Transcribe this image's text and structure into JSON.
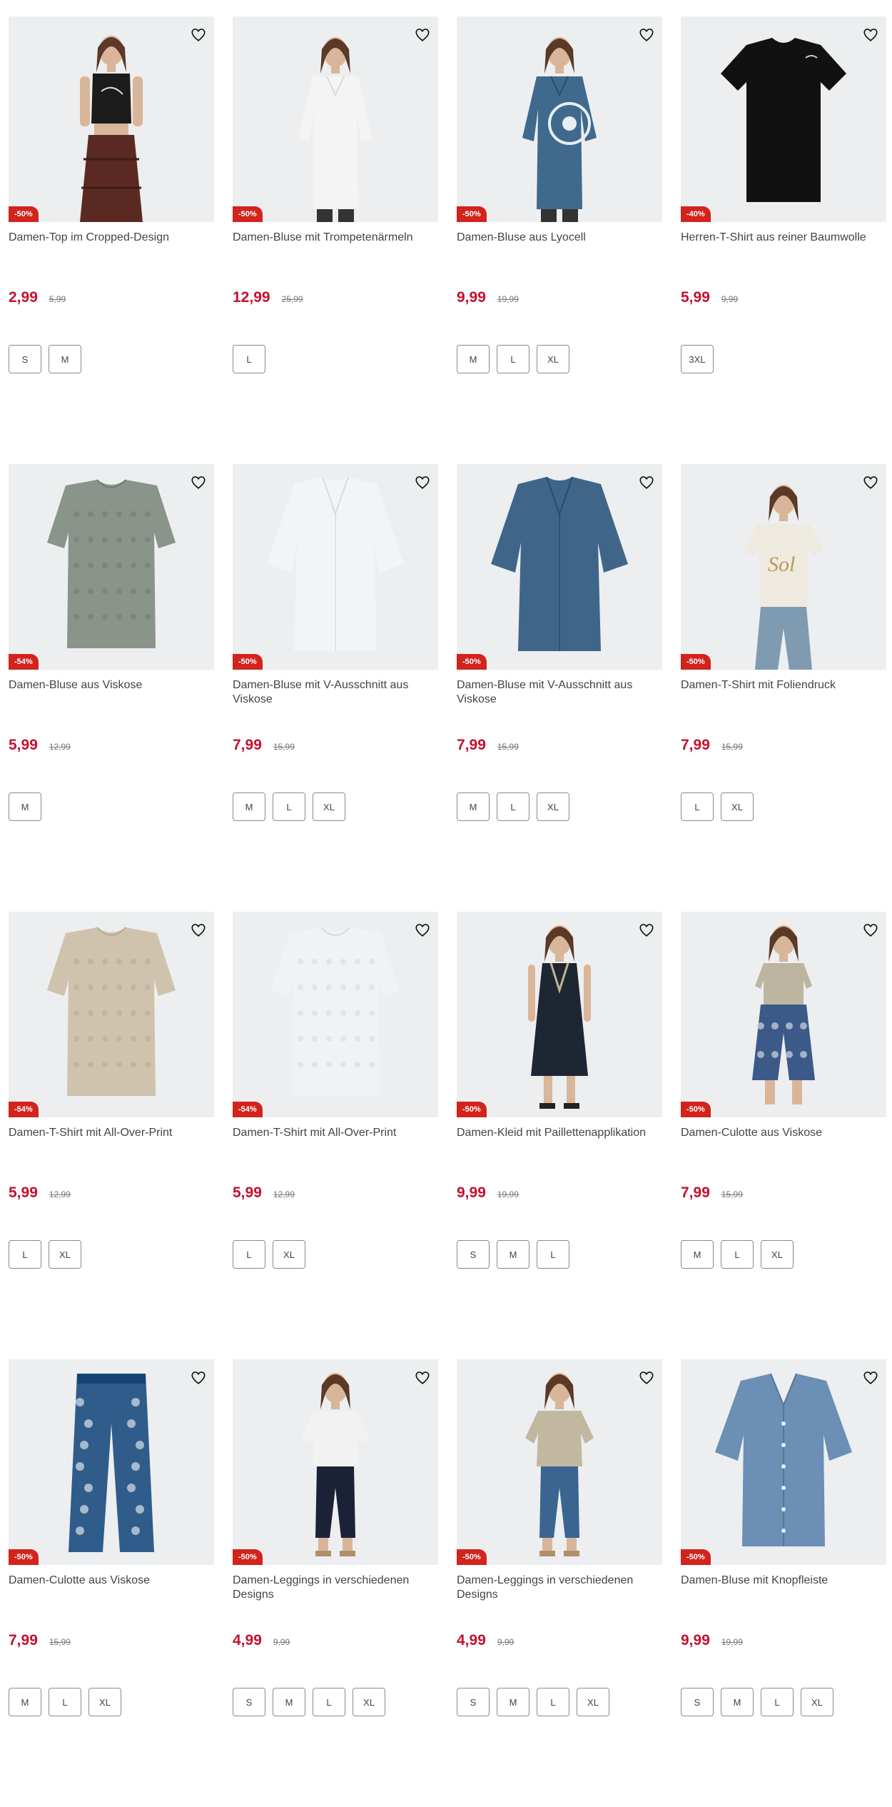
{
  "products": [
    {
      "title": "Damen-Top im Cropped-Design",
      "badge": "-50%",
      "price": "2,99",
      "old_price": "5,99",
      "sizes": [
        "S",
        "M"
      ],
      "art": "top",
      "color": "#1c1c1c"
    },
    {
      "title": "Damen-Bluse mit Trompetenärmeln",
      "badge": "-50%",
      "price": "12,99",
      "old_price": "25,99",
      "sizes": [
        "L"
      ],
      "art": "blouse-model",
      "color": "#f4f4f4"
    },
    {
      "title": "Damen-Bluse aus Lyocell",
      "badge": "-50%",
      "price": "9,99",
      "old_price": "19,99",
      "sizes": [
        "M",
        "L",
        "XL"
      ],
      "art": "blouse-model",
      "color": "#3f6a8e"
    },
    {
      "title": "Herren-T-Shirt aus reiner Baumwolle",
      "badge": "-40%",
      "price": "5,99",
      "old_price": "9,99",
      "sizes": [
        "3XL"
      ],
      "art": "tshirt",
      "color": "#111111"
    },
    {
      "title": "Damen-Bluse aus Viskose",
      "badge": "-54%",
      "price": "5,99",
      "old_price": "12,99",
      "sizes": [
        "M"
      ],
      "art": "tshirt-flat",
      "color": "#8a948a"
    },
    {
      "title": "Damen-Bluse mit V-Ausschnitt aus Viskose",
      "badge": "-50%",
      "price": "7,99",
      "old_price": "15,99",
      "sizes": [
        "M",
        "L",
        "XL"
      ],
      "art": "blouse-flat",
      "color": "#f3f4f6"
    },
    {
      "title": "Damen-Bluse mit V-Ausschnitt aus Viskose",
      "badge": "-50%",
      "price": "7,99",
      "old_price": "15,99",
      "sizes": [
        "M",
        "L",
        "XL"
      ],
      "art": "blouse-flat",
      "color": "#3f6688"
    },
    {
      "title": "Damen-T-Shirt mit Foliendruck",
      "badge": "-50%",
      "price": "7,99",
      "old_price": "15,99",
      "sizes": [
        "L",
        "XL"
      ],
      "art": "tshirt-model",
      "color": "#efeae0"
    },
    {
      "title": "Damen-T-Shirt mit All-Over-Print",
      "badge": "-54%",
      "price": "5,99",
      "old_price": "12,99",
      "sizes": [
        "L",
        "XL"
      ],
      "art": "tshirt-flat",
      "color": "#cfc3ae"
    },
    {
      "title": "Damen-T-Shirt mit All-Over-Print",
      "badge": "-54%",
      "price": "5,99",
      "old_price": "12,99",
      "sizes": [
        "L",
        "XL"
      ],
      "art": "tshirt-flat",
      "color": "#f1f2f3"
    },
    {
      "title": "Damen-Kleid mit Paillettenapplikation",
      "badge": "-50%",
      "price": "9,99",
      "old_price": "19,99",
      "sizes": [
        "S",
        "M",
        "L"
      ],
      "art": "dress-model",
      "color": "#1e2533"
    },
    {
      "title": "Damen-Culotte aus Viskose",
      "badge": "-50%",
      "price": "7,99",
      "old_price": "15,99",
      "sizes": [
        "M",
        "L",
        "XL"
      ],
      "art": "pants-model",
      "color": "#3b5a88"
    },
    {
      "title": "Damen-Culotte aus Viskose",
      "badge": "-50%",
      "price": "7,99",
      "old_price": "15,99",
      "sizes": [
        "M",
        "L",
        "XL"
      ],
      "art": "pants-flat",
      "color": "#2f5c8a"
    },
    {
      "title": "Damen-Leggings in verschiedenen Designs",
      "badge": "-50%",
      "price": "4,99",
      "old_price": "9,99",
      "sizes": [
        "S",
        "M",
        "L",
        "XL"
      ],
      "art": "leggings-model",
      "color": "#1b2238"
    },
    {
      "title": "Damen-Leggings in verschiedenen Designs",
      "badge": "-50%",
      "price": "4,99",
      "old_price": "9,99",
      "sizes": [
        "S",
        "M",
        "L",
        "XL"
      ],
      "art": "leggings-model",
      "color": "#3a6590"
    },
    {
      "title": "Damen-Bluse mit Knopfleiste",
      "badge": "-50%",
      "price": "9,99",
      "old_price": "19,99",
      "sizes": [
        "S",
        "M",
        "L",
        "XL"
      ],
      "art": "button-blouse",
      "color": "#6b8fb5"
    }
  ],
  "icons": {
    "favorite": "heart-outline-icon"
  }
}
